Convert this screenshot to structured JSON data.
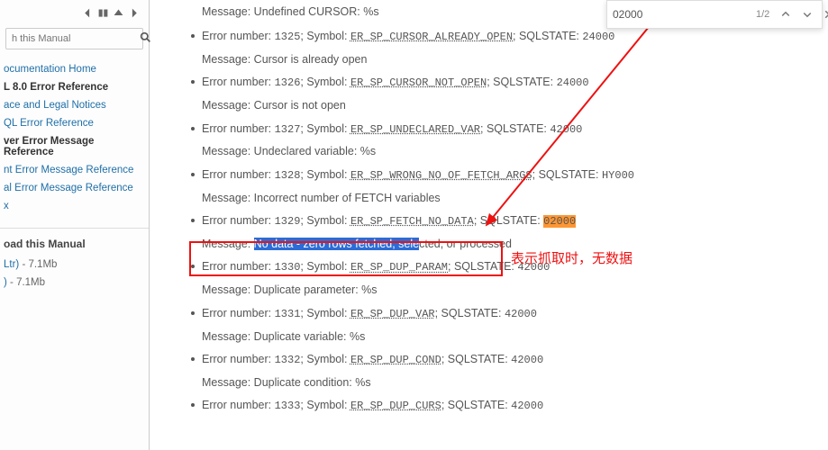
{
  "findbar": {
    "value": "02000",
    "count": "1/2"
  },
  "sidebar": {
    "search_placeholder": "h this Manual",
    "nav": {
      "home": "ocumentation Home",
      "section": "L 8.0 Error Reference",
      "items": [
        "ace and Legal Notices",
        "QL Error Reference",
        "ver Error Message Reference",
        "nt Error Message Reference",
        "al Error Message Reference",
        "x"
      ]
    },
    "download_head": "oad this Manual",
    "dl1_label": " Ltr)",
    "dl1_size": " - 7.1Mb",
    "dl2_label": ")",
    "dl2_size": " - 7.1Mb"
  },
  "preamble_message": "Message: Undefined CURSOR: %s",
  "errors": [
    {
      "num": "1325",
      "sym": "ER_SP_CURSOR_ALREADY_OPEN",
      "sql": "24000",
      "hl": false,
      "msg": "Cursor is already open"
    },
    {
      "num": "1326",
      "sym": "ER_SP_CURSOR_NOT_OPEN",
      "sql": "24000",
      "hl": false,
      "msg": "Cursor is not open"
    },
    {
      "num": "1327",
      "sym": "ER_SP_UNDECLARED_VAR",
      "sql": "42000",
      "hl": false,
      "msg": "Undeclared variable: %s"
    },
    {
      "num": "1328",
      "sym": "ER_SP_WRONG_NO_OF_FETCH_ARGS",
      "sql": "HY000",
      "hl": false,
      "msg": "Incorrect number of FETCH variables"
    },
    {
      "num": "1329",
      "sym": "ER_SP_FETCH_NO_DATA",
      "sql": "02000",
      "hl": true,
      "msg_sel": "No data - zero rows fetched, sele",
      "msg_rest": "cted, or processed"
    },
    {
      "num": "1330",
      "sym": "ER_SP_DUP_PARAM",
      "sql": "42000",
      "hl": false,
      "msg": "Duplicate parameter: %s"
    },
    {
      "num": "1331",
      "sym": "ER_SP_DUP_VAR",
      "sql": "42000",
      "hl": false,
      "msg": "Duplicate variable: %s"
    },
    {
      "num": "1332",
      "sym": "ER_SP_DUP_COND",
      "sql": "42000",
      "hl": false,
      "msg": "Duplicate condition: %s"
    },
    {
      "num": "1333",
      "sym": "ER_SP_DUP_CURS",
      "sql": "42000",
      "hl": false,
      "msg": ""
    }
  ],
  "annotation": "表示抓取时，无数据"
}
